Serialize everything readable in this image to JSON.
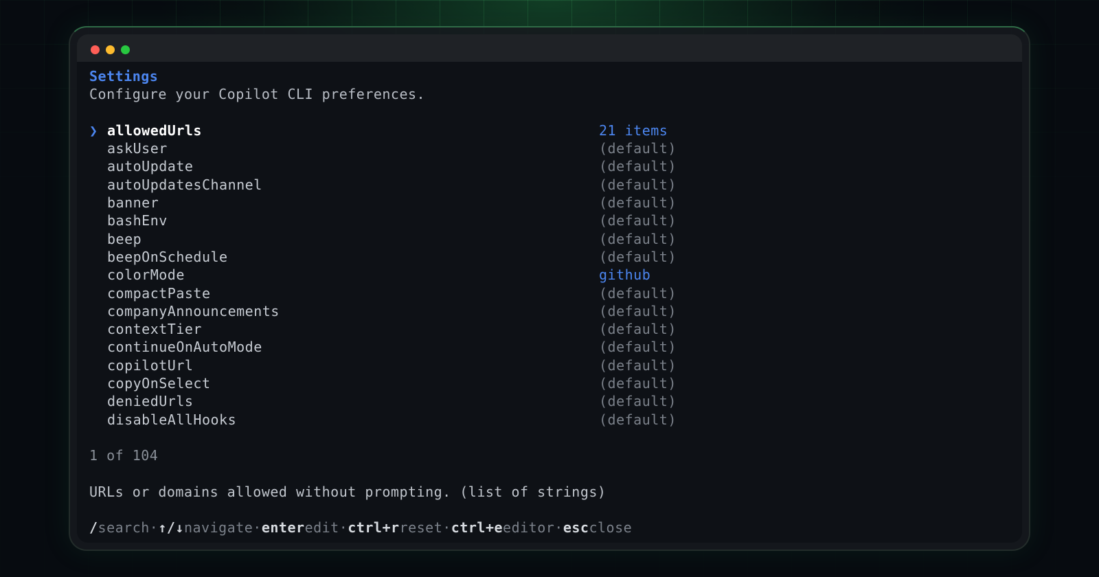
{
  "header": {
    "title": "Settings",
    "subtitle": "Configure your Copilot CLI preferences."
  },
  "selection_marker": "❯",
  "settings": [
    {
      "name": "allowedUrls",
      "value": "21 items"
    },
    {
      "name": "askUser",
      "value": "(default)"
    },
    {
      "name": "autoUpdate",
      "value": "(default)"
    },
    {
      "name": "autoUpdatesChannel",
      "value": "(default)"
    },
    {
      "name": "banner",
      "value": "(default)"
    },
    {
      "name": "bashEnv",
      "value": "(default)"
    },
    {
      "name": "beep",
      "value": "(default)"
    },
    {
      "name": "beepOnSchedule",
      "value": "(default)"
    },
    {
      "name": "colorMode",
      "value": "github"
    },
    {
      "name": "compactPaste",
      "value": "(default)"
    },
    {
      "name": "companyAnnouncements",
      "value": "(default)"
    },
    {
      "name": "contextTier",
      "value": "(default)"
    },
    {
      "name": "continueOnAutoMode",
      "value": "(default)"
    },
    {
      "name": "copilotUrl",
      "value": "(default)"
    },
    {
      "name": "copyOnSelect",
      "value": "(default)"
    },
    {
      "name": "deniedUrls",
      "value": "(default)"
    },
    {
      "name": "disableAllHooks",
      "value": "(default)"
    }
  ],
  "counter": "1 of 104",
  "description": "URLs or domains allowed without prompting. (list of strings)",
  "help": [
    {
      "key": "/",
      "desc": "search"
    },
    {
      "key": "↑/↓",
      "desc": "navigate"
    },
    {
      "key": "enter",
      "desc": "edit"
    },
    {
      "key": "ctrl+r",
      "desc": "reset"
    },
    {
      "key": "ctrl+e",
      "desc": "editor"
    },
    {
      "key": "esc",
      "desc": "close"
    }
  ],
  "help_separator": "·",
  "colors": {
    "accent": "#4c86f0",
    "muted": "#7b818a",
    "text": "#c7ccd3",
    "background": "#0e1116",
    "dot_red": "#ff5f57",
    "dot_yellow": "#febc2e",
    "dot_green": "#28c840"
  }
}
